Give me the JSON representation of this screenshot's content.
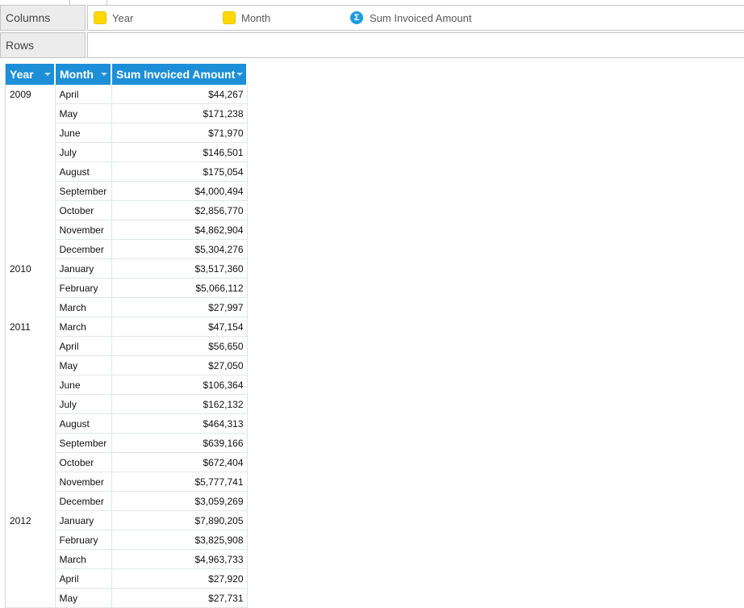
{
  "shelves": {
    "columns": {
      "label": "Columns",
      "chips": [
        {
          "name": "Year",
          "kind": "dimension",
          "icon": "dimension-icon"
        },
        {
          "name": "Month",
          "kind": "dimension",
          "icon": "dimension-icon"
        },
        {
          "name": "Sum Invoiced Amount",
          "kind": "measure",
          "icon": "sum-measure-icon",
          "glyph": "Σ"
        }
      ]
    },
    "rows": {
      "label": "Rows"
    }
  },
  "table": {
    "headers": [
      "Year",
      "Month",
      "Sum Invoiced Amount"
    ],
    "header_color": "#1d8fd8",
    "groups": [
      {
        "year": "2009",
        "rows": [
          [
            "April",
            "$44,267"
          ],
          [
            "May",
            "$171,238"
          ],
          [
            "June",
            "$71,970"
          ],
          [
            "July",
            "$146,501"
          ],
          [
            "August",
            "$175,054"
          ],
          [
            "September",
            "$4,000,494"
          ],
          [
            "October",
            "$2,856,770"
          ],
          [
            "November",
            "$4,862,904"
          ],
          [
            "December",
            "$5,304,276"
          ]
        ]
      },
      {
        "year": "2010",
        "rows": [
          [
            "January",
            "$3,517,360"
          ],
          [
            "February",
            "$5,066,112"
          ],
          [
            "March",
            "$27,997"
          ]
        ]
      },
      {
        "year": "2011",
        "rows": [
          [
            "March",
            "$47,154"
          ],
          [
            "April",
            "$56,650"
          ],
          [
            "May",
            "$27,050"
          ],
          [
            "June",
            "$106,364"
          ],
          [
            "July",
            "$162,132"
          ],
          [
            "August",
            "$464,313"
          ],
          [
            "September",
            "$639,166"
          ],
          [
            "October",
            "$672,404"
          ],
          [
            "November",
            "$5,777,741"
          ],
          [
            "December",
            "$3,059,269"
          ]
        ]
      },
      {
        "year": "2012",
        "rows": [
          [
            "January",
            "$7,890,205"
          ],
          [
            "February",
            "$3,825,908"
          ],
          [
            "March",
            "$4,963,733"
          ],
          [
            "April",
            "$27,920"
          ],
          [
            "May",
            "$27,731"
          ]
        ]
      }
    ]
  }
}
